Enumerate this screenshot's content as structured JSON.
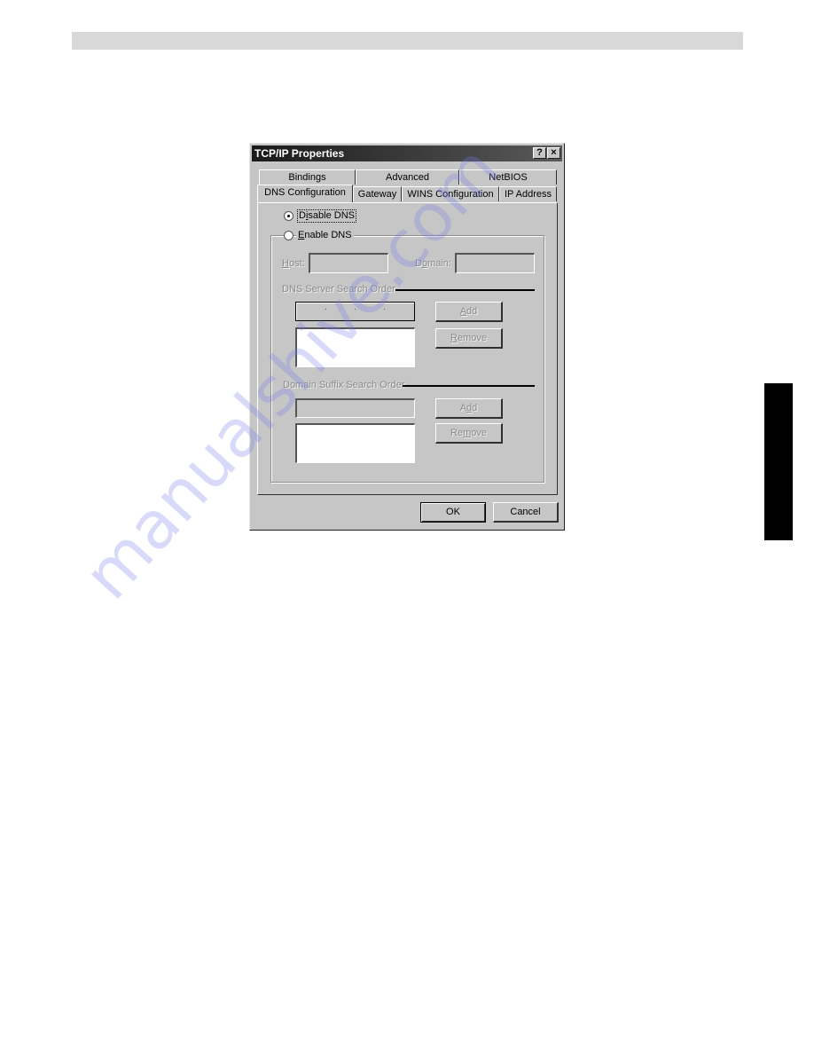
{
  "dialog": {
    "title": "TCP/IP Properties",
    "help_button": "?",
    "close_button": "×",
    "tabs_back_row": [
      "Bindings",
      "Advanced",
      "NetBIOS"
    ],
    "tabs_front_row": [
      "DNS Configuration",
      "Gateway",
      "WINS Configuration",
      "IP Address"
    ],
    "active_tab": "DNS Configuration",
    "disable_dns": {
      "prefix": "D",
      "accel": "i",
      "rest": "sable DNS",
      "selected": true
    },
    "enable_dns": {
      "accel": "E",
      "rest": "nable DNS",
      "selected": false
    },
    "host_label": {
      "accel": "H",
      "rest": "ost:"
    },
    "host_value": "",
    "domain_label": {
      "prefix": "D",
      "accel": "o",
      "rest": "main:"
    },
    "domain_value": "",
    "dns_server_section": "DNS Server Search Order",
    "dns_ip_value": [
      "",
      "",
      "",
      ""
    ],
    "dns_add": {
      "accel": "A",
      "rest": "dd"
    },
    "dns_remove": {
      "accel": "R",
      "rest": "emove"
    },
    "domain_suffix_section": "Domain Suffix Search Order",
    "suffix_value": "",
    "suffix_add": {
      "prefix": "A",
      "accel": "d",
      "rest": "d"
    },
    "suffix_remove": {
      "prefix": "Re",
      "accel": "m",
      "rest": "ove"
    },
    "ok_label": "OK",
    "cancel_label": "Cancel"
  },
  "watermark": "manualshive.com"
}
